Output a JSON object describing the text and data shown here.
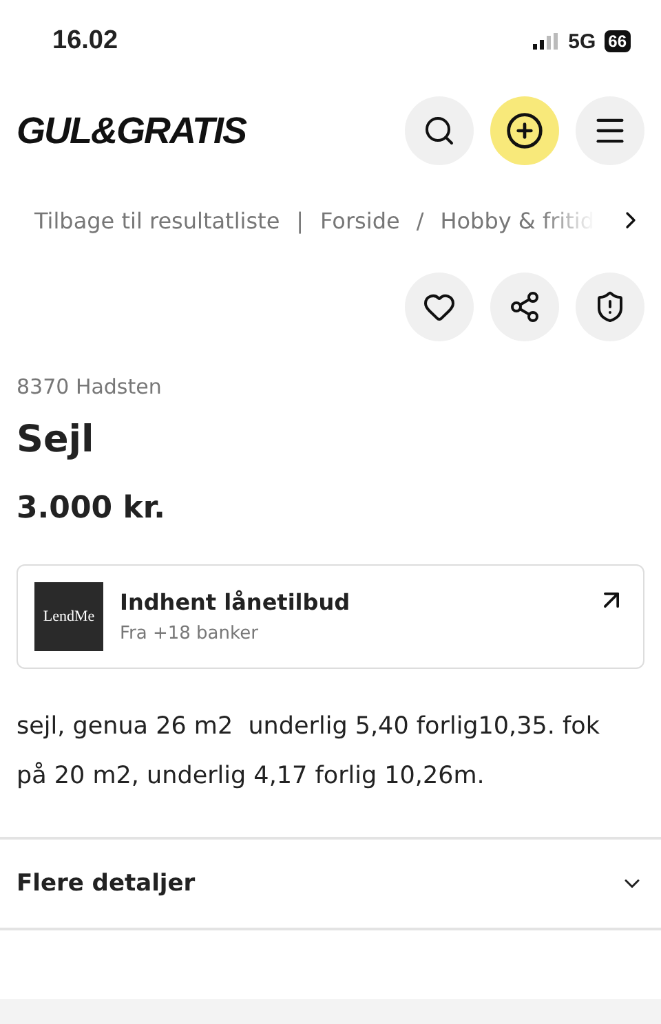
{
  "status_bar": {
    "time": "16.02",
    "network": "5G",
    "battery": "66"
  },
  "header": {
    "logo": "GUL&GRATIS"
  },
  "breadcrumb": {
    "back": "Tilbage til resultatliste",
    "separator_1": "|",
    "items": [
      "Forside",
      "Hobby & fritid"
    ],
    "separator_2": "/"
  },
  "listing": {
    "location": "8370 Hadsten",
    "title": "Sejl",
    "price": "3.000 kr.",
    "loan_card": {
      "logo": "LendMe",
      "title": "Indhent lånetilbud",
      "subtitle": "Fra +18 banker"
    },
    "description": "sejl, genua 26 m2  underlig 5,40 forlig10,35. fok på 20 m2, underlig 4,17 forlig 10,26m."
  },
  "details": {
    "label": "Flere detaljer",
    "expanded": false
  }
}
